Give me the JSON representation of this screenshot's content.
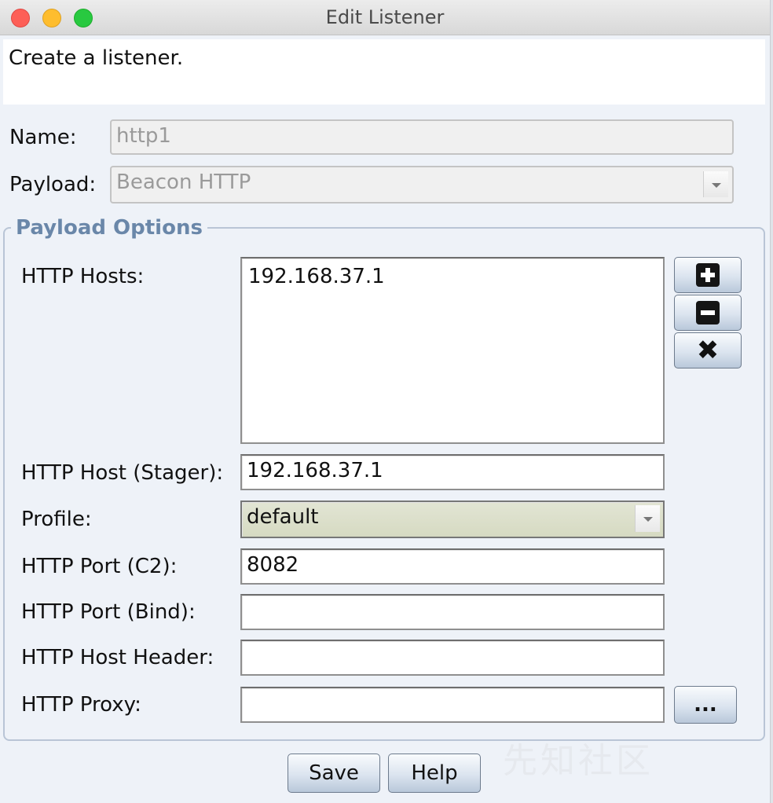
{
  "window": {
    "title": "Edit Listener"
  },
  "description": "Create a listener.",
  "name": {
    "label": "Name:",
    "value": "http1"
  },
  "payload": {
    "label": "Payload:",
    "value": "Beacon HTTP"
  },
  "payload_options": {
    "title": "Payload Options",
    "http_hosts": {
      "label": "HTTP Hosts:",
      "items": [
        "192.168.37.1"
      ]
    },
    "host_stager": {
      "label": "HTTP Host (Stager):",
      "value": "192.168.37.1"
    },
    "profile": {
      "label": "Profile:",
      "value": "default"
    },
    "port_c2": {
      "label": "HTTP Port (C2):",
      "value": "8082"
    },
    "port_bind": {
      "label": "HTTP Port (Bind):",
      "value": ""
    },
    "host_header": {
      "label": "HTTP Host Header:",
      "value": ""
    },
    "proxy": {
      "label": "HTTP Proxy:",
      "value": "",
      "button": "..."
    }
  },
  "buttons": {
    "save": "Save",
    "help": "Help"
  },
  "watermark": "先知社区",
  "icons": [
    "add-icon",
    "remove-icon",
    "clear-icon",
    "dropdown-arrow-icon"
  ]
}
